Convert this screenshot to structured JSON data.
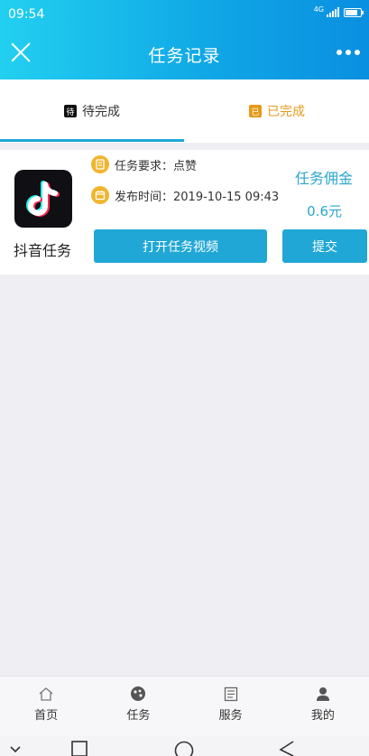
{
  "status_bar": {
    "time": "09:54",
    "network": "4G",
    "battery_level": 0.8
  },
  "header": {
    "title": "任务记录"
  },
  "tabs": [
    {
      "label": "待完成",
      "icon_char": "待",
      "active": true
    },
    {
      "label": "已完成",
      "icon_char": "已",
      "active": false
    }
  ],
  "task": {
    "app_name": "抖音任务",
    "requirement": "任务要求：点赞",
    "publish_time": "发布时间：2019-10-15 09:43",
    "commission_label": "任务佣金",
    "commission_value": "0.6元",
    "open_button": "打开任务视频",
    "submit_button": "提交"
  },
  "bottom_nav": [
    {
      "label": "首页",
      "icon": "home-icon"
    },
    {
      "label": "任务",
      "icon": "task-icon"
    },
    {
      "label": "服务",
      "icon": "service-icon"
    },
    {
      "label": "我的",
      "icon": "profile-icon"
    }
  ],
  "colors": {
    "accent": "#20a7d6",
    "done_tab": "#e69a1b",
    "info_icon": "#f0b530"
  }
}
